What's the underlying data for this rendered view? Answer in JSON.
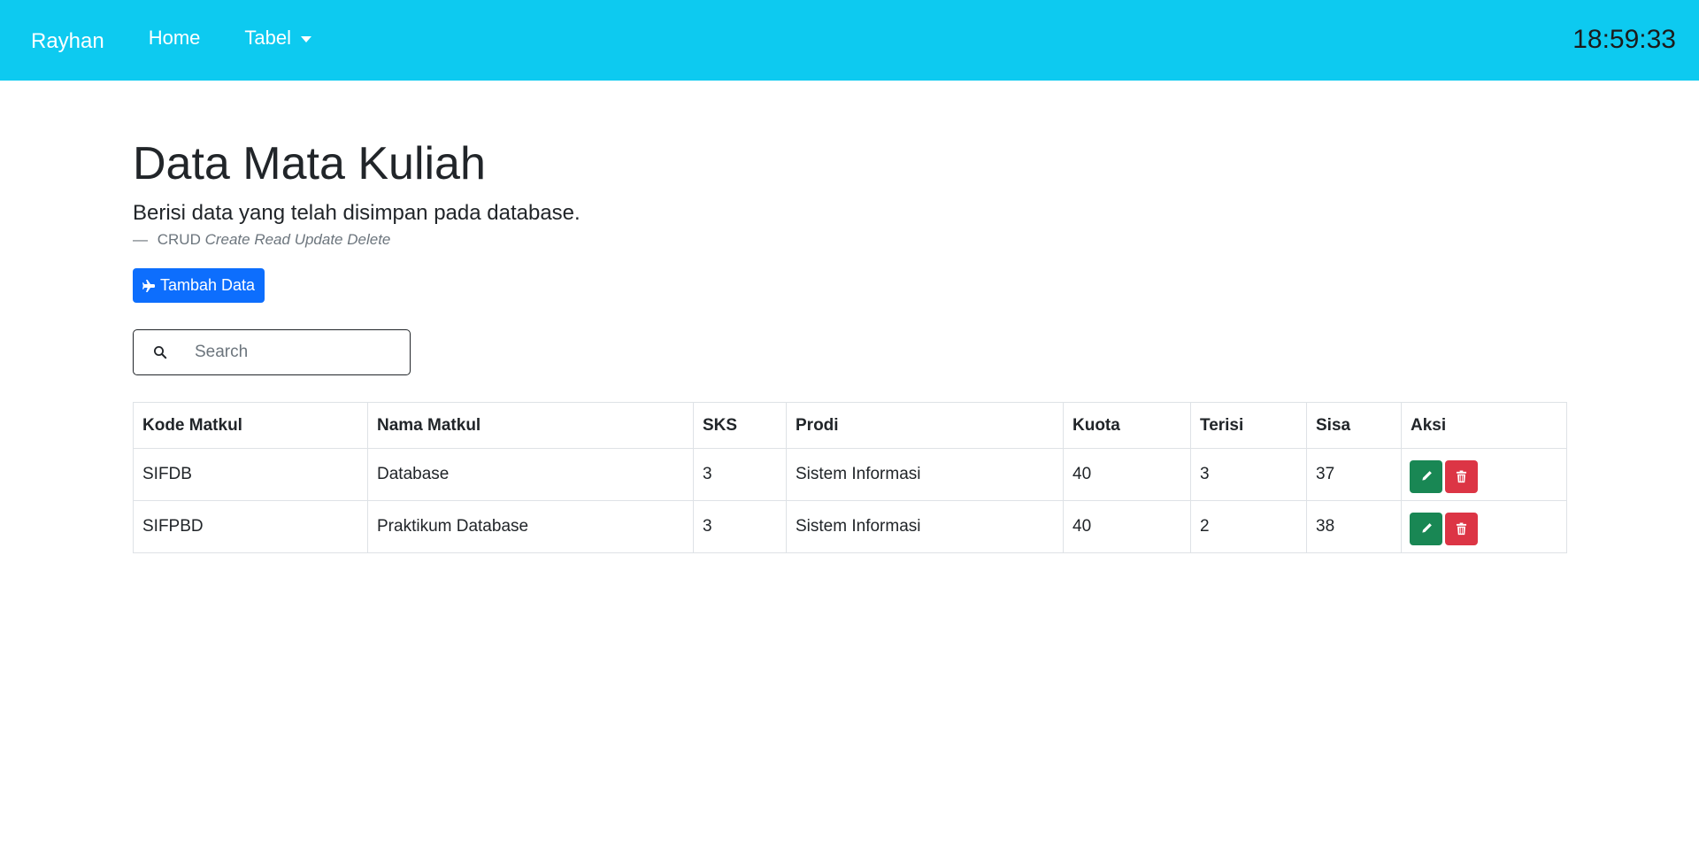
{
  "navbar": {
    "brand": "Rayhan",
    "links": [
      {
        "label": "Home"
      },
      {
        "label": "Tabel",
        "dropdown": true
      }
    ],
    "clock": "18:59:33",
    "background": "#0dcaf0"
  },
  "header": {
    "title": "Data Mata Kuliah",
    "lead": "Berisi data yang telah disimpan pada database.",
    "footer_prefix": "CRUD",
    "footer_emphasis": "Create Read Update Delete"
  },
  "actions": {
    "add_label": "Tambah Data",
    "add_icon": "plane-icon"
  },
  "search": {
    "placeholder": "Search",
    "value": "",
    "icon": "search-icon"
  },
  "table": {
    "columns": [
      "Kode Matkul",
      "Nama Matkul",
      "SKS",
      "Prodi",
      "Kuota",
      "Terisi",
      "Sisa",
      "Aksi"
    ],
    "rows": [
      {
        "kode": "SIFDB",
        "nama": "Database",
        "sks": "3",
        "prodi": "Sistem Informasi",
        "kuota": "40",
        "terisi": "3",
        "sisa": "37"
      },
      {
        "kode": "SIFPBD",
        "nama": "Praktikum Database",
        "sks": "3",
        "prodi": "Sistem Informasi",
        "kuota": "40",
        "terisi": "2",
        "sisa": "38"
      }
    ],
    "row_actions": [
      {
        "icon": "pencil-icon",
        "color": "#198754"
      },
      {
        "icon": "trash-icon",
        "color": "#dc3545"
      }
    ]
  }
}
